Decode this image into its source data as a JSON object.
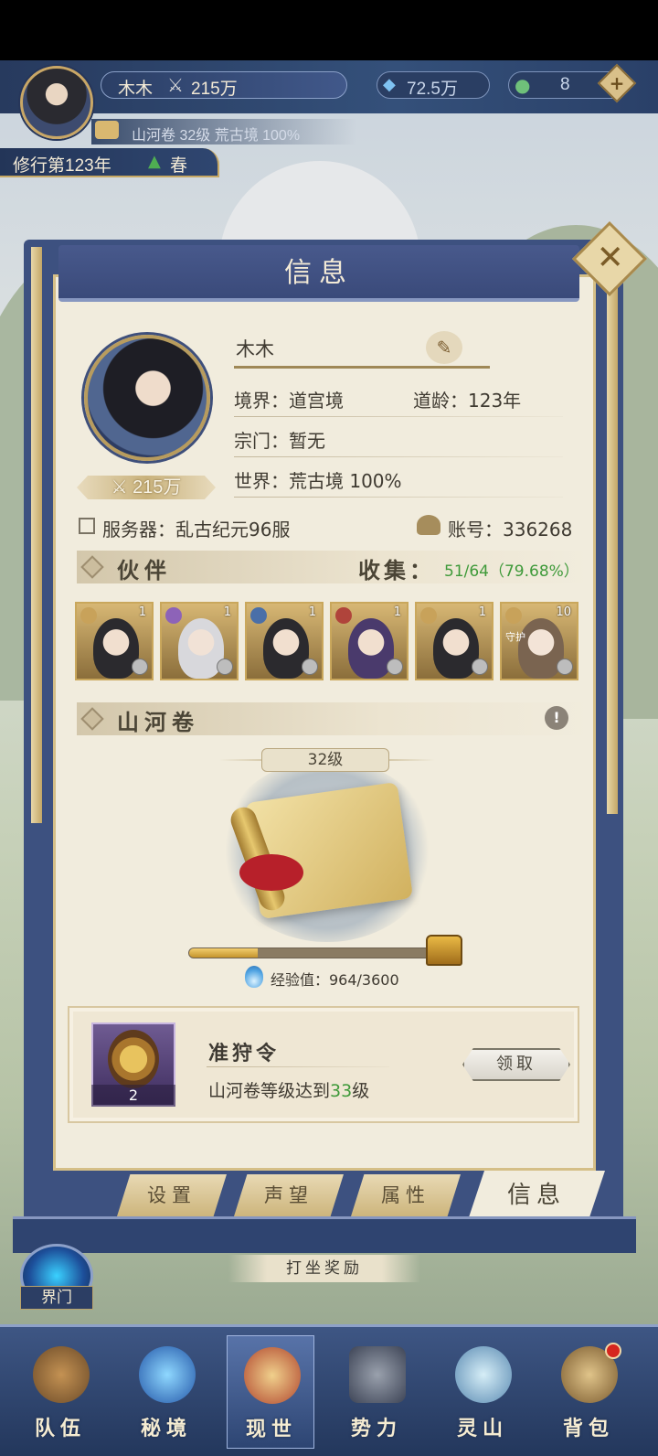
{
  "header": {
    "player_name": "木木",
    "power": "215万",
    "currency_jade": "72.5万",
    "currency_coin": "8",
    "plus_label": "+",
    "scroll_status": "山河卷 32级 荒古境 100%",
    "year_label": "修行第123年",
    "season": "春"
  },
  "panel": {
    "title": "信息",
    "close_label": "✕",
    "profile": {
      "name": "木木",
      "realm": "境界：道宫境",
      "dao_age": "道龄：123年",
      "sect": "宗门：暂无",
      "world": "世界：荒古境  100%",
      "power": "215万",
      "server": "服务器：乱古纪元96服",
      "account": "账号：336268"
    },
    "partners": {
      "title": "伙伴",
      "collect_label": "收集：",
      "collect_value": "51/64（79.68%）",
      "cards": [
        {
          "level": "1",
          "faction_color": "#c8a25a",
          "tag": ""
        },
        {
          "level": "1",
          "faction_color": "#8d63b8",
          "tag": ""
        },
        {
          "level": "1",
          "faction_color": "#4a6fa8",
          "tag": ""
        },
        {
          "level": "1",
          "faction_color": "#b0443b",
          "tag": ""
        },
        {
          "level": "1",
          "faction_color": "#c8a25a",
          "tag": ""
        },
        {
          "level": "10",
          "faction_color": "#c8a25a",
          "tag": "守护"
        }
      ]
    },
    "scroll": {
      "title": "山河卷",
      "level": "32级",
      "xp_label": "经验值：964/3600",
      "xp_current": 964,
      "xp_max": 3600
    },
    "reward": {
      "name": "准狩令",
      "count": "2",
      "condition_prefix": "山河卷等级达到",
      "condition_level": "33",
      "condition_suffix": "级",
      "claim_label": "领取",
      "highlight_color": "#3f9a3a"
    },
    "tabs": [
      "设置",
      "声望",
      "属性",
      "信息"
    ],
    "active_tab": "信息"
  },
  "bottom": {
    "gate_label": "界门",
    "meditate_label": "打坐奖励",
    "nav": [
      "队伍",
      "秘境",
      "现世",
      "势力",
      "灵山",
      "背包"
    ],
    "nav_active": "现世"
  },
  "colors": {
    "accent_green": "#3f9a3a",
    "panel_blue": "#3d5180",
    "gold": "#c6a864"
  }
}
